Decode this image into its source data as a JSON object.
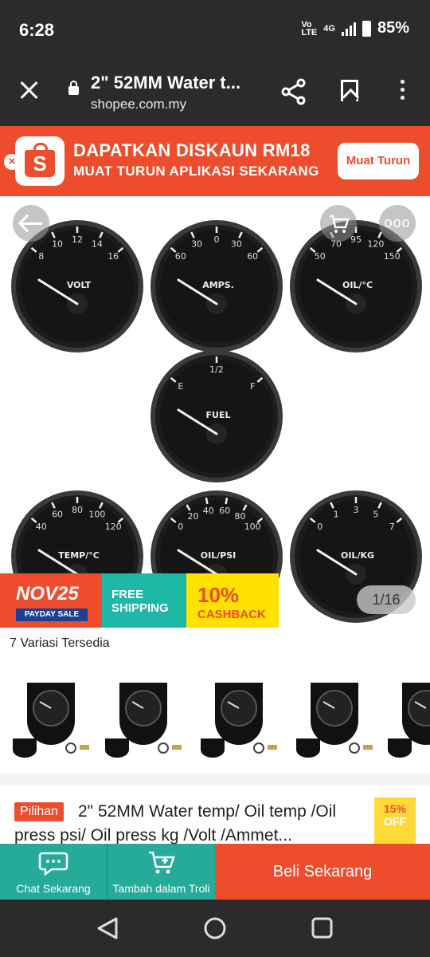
{
  "status_bar": {
    "time": "6:28",
    "volte": "Vo LTE",
    "network": "4G",
    "battery": "85%"
  },
  "toolbar": {
    "title": "2\" 52MM Water t...",
    "url": "shopee.com.my"
  },
  "app_banner": {
    "headline": "DAPATKAN DISKAUN RM18",
    "subline": "MUAT TURUN APLIKASI SEKARANG",
    "button": "Muat Turun",
    "logo_letter": "S",
    "close": "×"
  },
  "gallery": {
    "more": "ooo",
    "counter": "1/16",
    "gauges": [
      {
        "label": "VOLT",
        "ticks": [
          "8",
          "10",
          "12",
          "14",
          "16"
        ]
      },
      {
        "label": "AMPS.",
        "ticks": [
          "60",
          "30",
          "0",
          "30",
          "60"
        ]
      },
      {
        "label": "OIL/°C",
        "ticks": [
          "50",
          "70",
          "95",
          "120",
          "150"
        ]
      },
      {
        "label": "FUEL",
        "ticks": [
          "E",
          "1/2",
          "F"
        ]
      },
      {
        "label": "TEMP/°C",
        "ticks": [
          "40",
          "60",
          "80",
          "100",
          "120"
        ]
      },
      {
        "label": "OIL/PSI",
        "ticks": [
          "0",
          "20",
          "40",
          "60",
          "80",
          "100"
        ]
      },
      {
        "label": "OIL/KG",
        "ticks": [
          "0",
          "1",
          "3",
          "5",
          "7"
        ]
      }
    ],
    "promo": {
      "nov": "NOV25",
      "payday": "PAYDAY SALE",
      "shipping1": "FREE",
      "shipping2": "SHIPPING",
      "cashback_pct": "10%",
      "cashback": "CASHBACK"
    }
  },
  "variations": {
    "label": "7 Variasi Tersedia"
  },
  "product": {
    "badge": "Pilihan",
    "title": "2\" 52MM Water temp/ Oil temp /Oil press psi/ Oil press kg /Volt /Ammet...",
    "discount_pct": "15%",
    "discount_off": "OFF"
  },
  "actions": {
    "chat": "Chat Sekarang",
    "cart": "Tambah dalam Troli",
    "buy": "Beli Sekarang"
  },
  "colors": {
    "brand": "#ee4d2d",
    "teal": "#26aa99",
    "dark": "#2b2b2b"
  }
}
